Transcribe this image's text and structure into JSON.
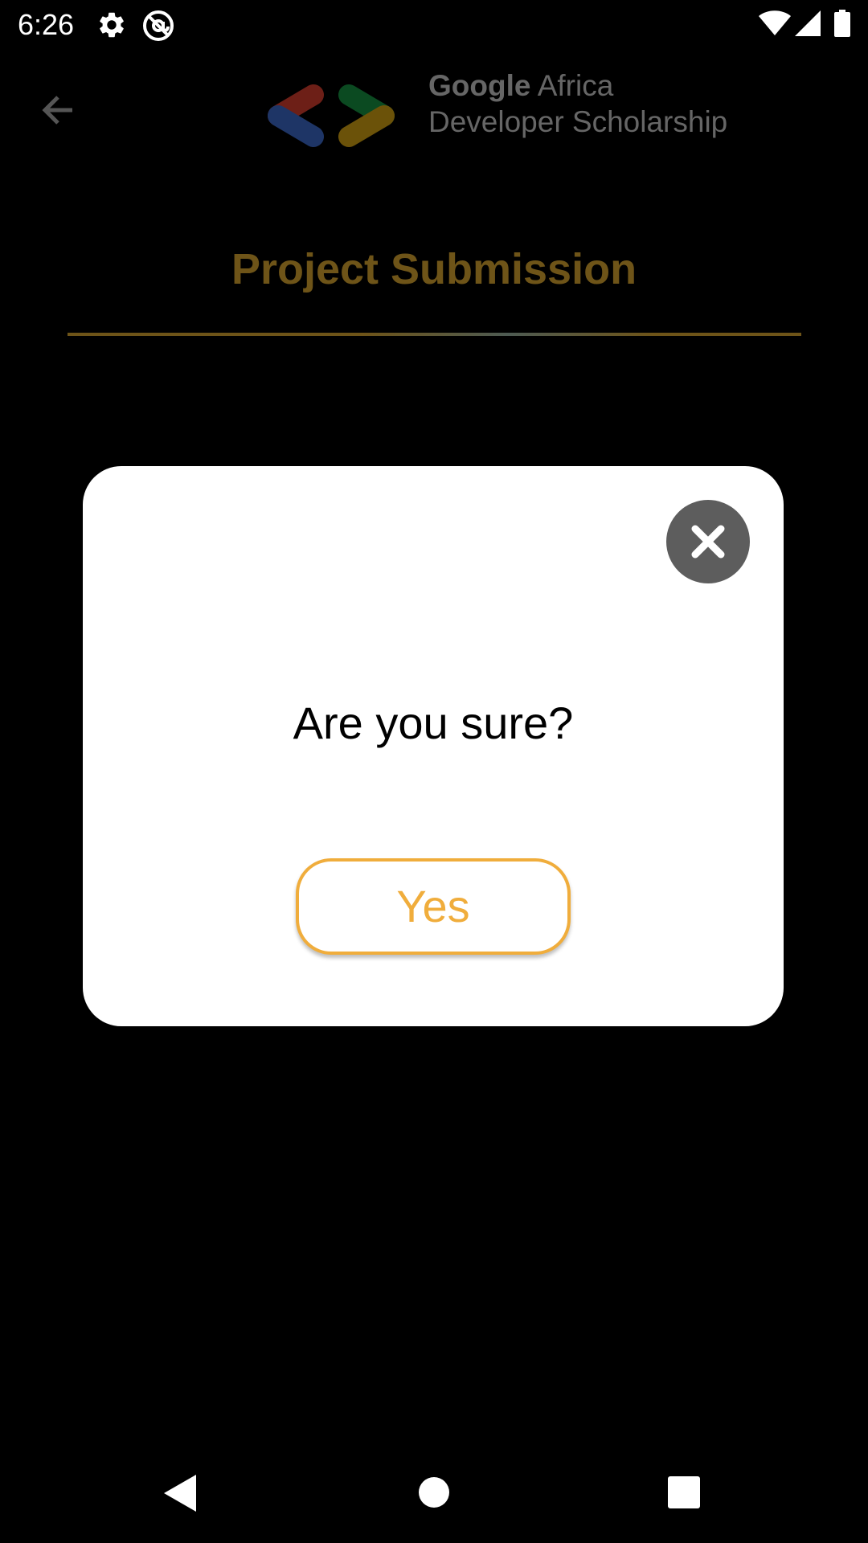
{
  "status_bar": {
    "time": "6:26",
    "icons": [
      "gear-icon",
      "at-sign-icon",
      "wifi-icon",
      "cell-signal-icon",
      "battery-icon"
    ]
  },
  "header": {
    "back_icon": "arrow-left-icon",
    "logo_icon": "developer-brackets-logo",
    "brand_google": "Google",
    "brand_africa": "Africa",
    "brand_line2": "Developer Scholarship"
  },
  "page": {
    "title": "Project Submission"
  },
  "dialog": {
    "close_icon": "close-icon",
    "question": "Are you sure?",
    "confirm_label": "Yes"
  },
  "nav_bar": {
    "items": [
      "back-triangle-icon",
      "home-circle-icon",
      "recents-square-icon"
    ]
  },
  "colors": {
    "accent": "#f0ad3c",
    "title_dimmed": "#6e5418",
    "close_button": "#5d5d5d",
    "logo_red": "#c53727",
    "logo_blue": "#3560b8",
    "logo_green": "#138a3b",
    "logo_yellow": "#c2960e"
  }
}
